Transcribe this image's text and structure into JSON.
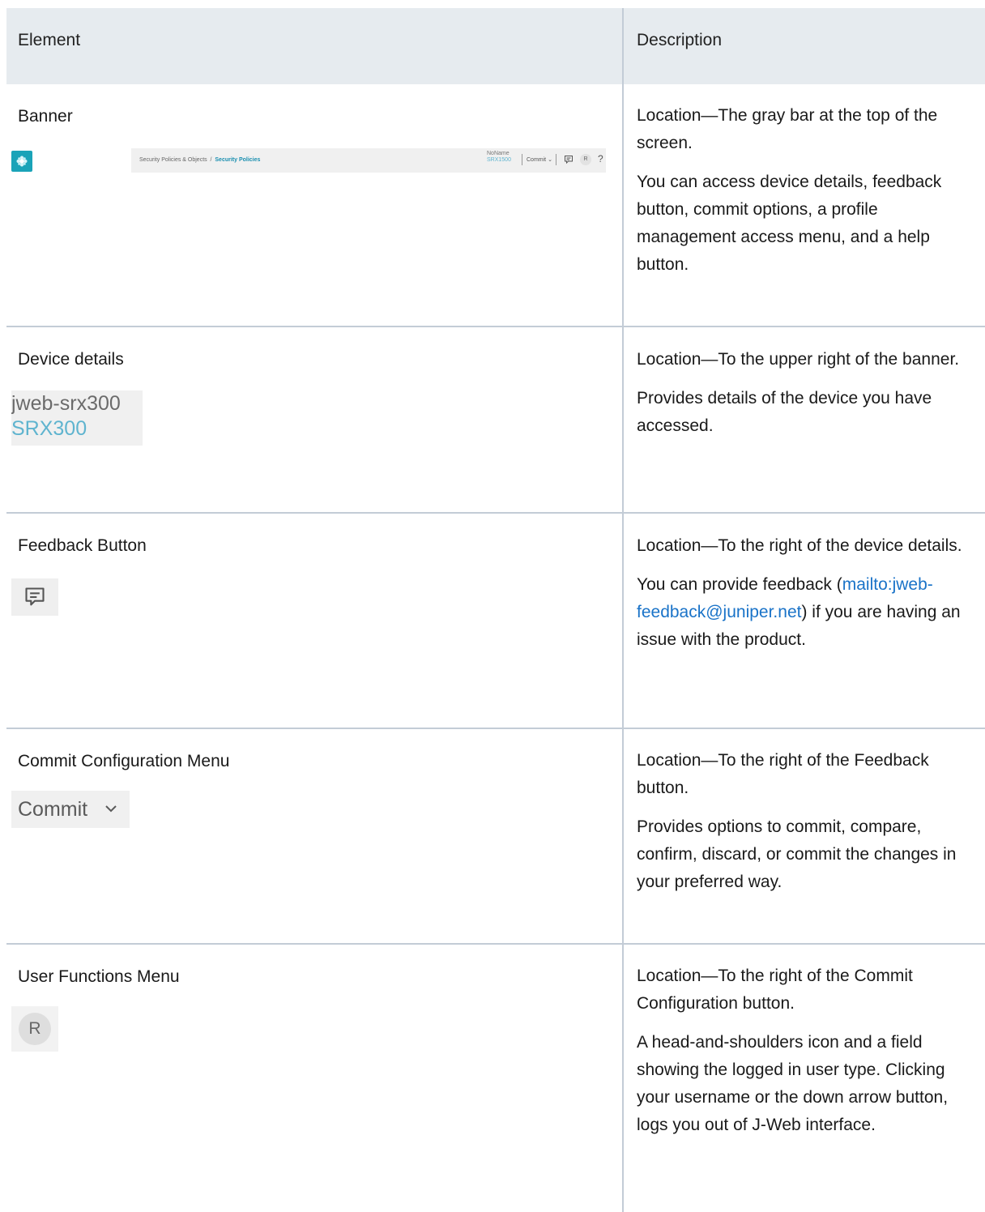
{
  "table": {
    "headers": {
      "element": "Element",
      "description": "Description"
    },
    "rows": [
      {
        "element": "Banner",
        "description": [
          "Location—The gray bar at the top of the screen.",
          "You can access device details, feedback button, commit options, a profile management access menu, and a help button."
        ],
        "image": {
          "breadcrumb_parent": "Security Policies & Objects",
          "breadcrumb_separator": "/",
          "breadcrumb_current": "Security Policies",
          "device_name": "NoName",
          "device_model": "SRX1500",
          "commit_label": "Commit",
          "avatar_letter": "R",
          "help_label": "?"
        }
      },
      {
        "element": "Device details",
        "description": [
          "Location—To the upper right of the banner.",
          "Provides details of the device you have accessed."
        ],
        "image": {
          "device_name": "jweb-srx300",
          "device_model": "SRX300"
        }
      },
      {
        "element": "Feedback Button",
        "description": [
          "Location—To the right of the device details.",
          "You can provide feedback (",
          "mailto:jweb-feedback@juniper.net",
          ") if you are having an issue with the product."
        ]
      },
      {
        "element": "Commit Configuration Menu",
        "description": [
          "Location—To the right of the Feedback button.",
          "Provides options to commit, compare, confirm, discard, or commit the changes in your preferred way."
        ],
        "image": {
          "commit_label": "Commit"
        }
      },
      {
        "element": "User Functions Menu",
        "description": [
          "Location—To the right of the Commit Configuration button.",
          "A head-and-shoulders icon and a field showing the logged in user type. Clicking your username or the down arrow button, logs you out of J-Web interface."
        ],
        "image": {
          "avatar_letter": "R"
        }
      }
    ]
  },
  "colors": {
    "header_bg": "#e6ebef",
    "divider": "#c3ccd6",
    "link": "#1a73c8",
    "brand_teal": "#1aa3b8",
    "model_blue": "#5fb4cf"
  }
}
